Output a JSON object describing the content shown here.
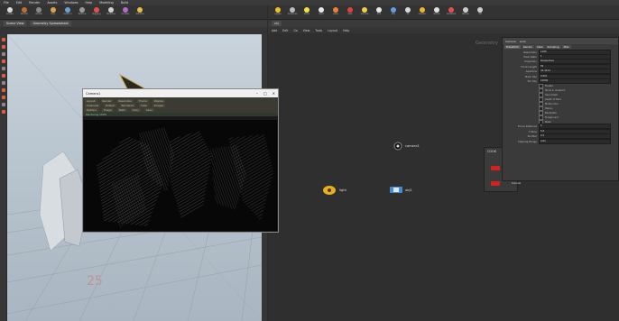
{
  "menubar": {
    "items": [
      "File",
      "Edit",
      "Render",
      "Assets",
      "Windows",
      "Help",
      "Modeling",
      "Build"
    ]
  },
  "shelf_left": {
    "tools": [
      {
        "label": "Create",
        "color": "#d9d9d9"
      },
      {
        "label": "Modify",
        "color": "#c07030"
      },
      {
        "label": "Model",
        "color": "#8a8a8a"
      },
      {
        "label": "Poly",
        "color": "#e0a040"
      },
      {
        "label": "Deform",
        "color": "#6aa0e0"
      },
      {
        "label": "Texture",
        "color": "#9a9a9a"
      },
      {
        "label": "Rigging",
        "color": "#e05050"
      },
      {
        "label": "Muscles",
        "color": "#d0d0d0"
      },
      {
        "label": "Crowds",
        "color": "#b06ad0"
      },
      {
        "label": "Volume",
        "color": "#e0c040"
      }
    ]
  },
  "shelf_right": {
    "tools": [
      {
        "label": "Lights",
        "color": "#f0c020"
      },
      {
        "label": "Cameras",
        "color": "#bbbbbb"
      },
      {
        "label": "Point",
        "color": "#f0e040"
      },
      {
        "label": "Spot",
        "color": "#e8e8e8"
      },
      {
        "label": "Area",
        "color": "#f08030"
      },
      {
        "label": "Geo",
        "color": "#e04040"
      },
      {
        "label": "Volume",
        "color": "#f0d040"
      },
      {
        "label": "Env",
        "color": "#e8e8e8"
      },
      {
        "label": "Sky",
        "color": "#60a0e0"
      },
      {
        "label": "GI",
        "color": "#d9d9d9"
      },
      {
        "label": "Caustic",
        "color": "#f0b030"
      },
      {
        "label": "Portal",
        "color": "#e0e0e0"
      },
      {
        "label": "Ambient",
        "color": "#e05050"
      },
      {
        "label": "Stereo",
        "color": "#cccccc"
      },
      {
        "label": "VR",
        "color": "#cccccc"
      }
    ]
  },
  "viewport_tabs": [
    "Scene View",
    "Geometry Spreadsheet"
  ],
  "viewport_label": "25",
  "net_menu": [
    "Add",
    "Edit",
    "Go",
    "View",
    "Tools",
    "Layout",
    "Help"
  ],
  "net_path": "obj",
  "geometry_watermark": "Geometry",
  "nodes": {
    "cam": "camera1",
    "light": "light",
    "geo": "obj1"
  },
  "popup": {
    "title": "Camera1",
    "rows": [
      [
        "Layout",
        "Render",
        "Resolution",
        "Frame",
        "Display"
      ],
      [
        "Channels",
        "Output",
        "Rendered",
        "View",
        "Images"
      ],
      [
        "Options",
        "Image",
        "Stats",
        "Copy",
        "Save"
      ]
    ],
    "status": "Rendering 100%"
  },
  "panel": {
    "header": [
      "Camera",
      "Look"
    ],
    "tabs": [
      "Transform",
      "Render",
      "View",
      "Sampling",
      "Misc"
    ],
    "rows": [
      {
        "k": "Resolution",
        "v": "1280"
      },
      {
        "k": "Pixel Ratio",
        "v": "1"
      },
      {
        "k": "Projection",
        "v": "Perspective"
      },
      {
        "k": "Focal Length",
        "v": "50"
      },
      {
        "k": "Aperture",
        "v": "41.4214"
      },
      {
        "k": "Near Clip",
        "v": "0.001"
      },
      {
        "k": "Far Clip",
        "v": "10000"
      }
    ],
    "checks": [
      "Enable",
      "Show in viewport",
      "Use lookat",
      "Depth of field",
      "Motion blur",
      "Stereo",
      "Backplate",
      "Foreground",
      "Mask"
    ],
    "rows2": [
      {
        "k": "Focus Distance",
        "v": "5"
      },
      {
        "k": "F-Stop",
        "v": "5.6"
      },
      {
        "k": "Shutter",
        "v": "0.5"
      },
      {
        "k": "Clipping Range",
        "v": "Auto"
      }
    ]
  },
  "redpanel": {
    "title": "COOK",
    "btn1": "Cook",
    "btn2": "Cancel"
  }
}
